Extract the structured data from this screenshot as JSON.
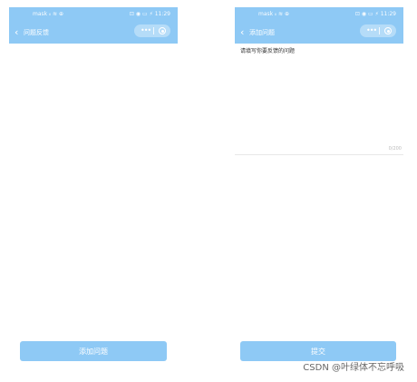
{
  "status_bar": {
    "left": "mask ᵢₗ ≋ ⊕",
    "right": "⊡ ◉ ▭ ⚡ 11:29"
  },
  "screens": [
    {
      "title": "问题反馈",
      "bottom_button_label": "添加问题"
    },
    {
      "title": "添加问题",
      "question_placeholder": "请填写你要反馈的问题",
      "counter": "0/200",
      "bottom_button_label": "提交"
    }
  ],
  "watermark": "CSDN @叶绿体不忘呼吸",
  "colors": {
    "header_bg": "#8ec9f5",
    "button_bg": "#8ec9f5",
    "page_bg": "#ffffff"
  }
}
